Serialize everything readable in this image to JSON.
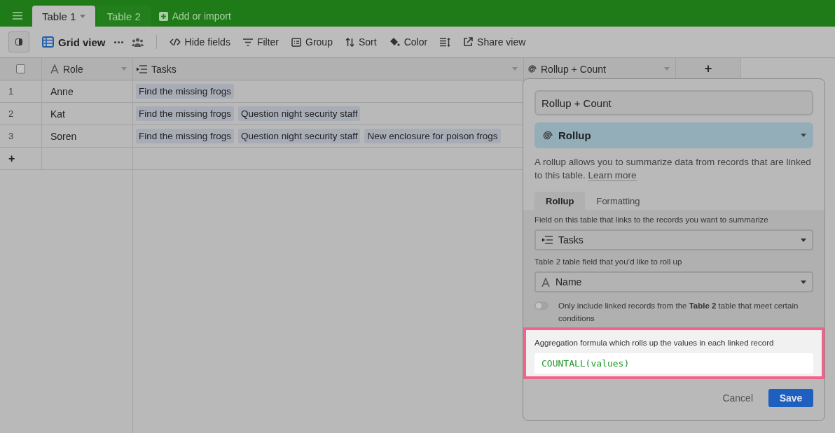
{
  "top_tabs": [
    {
      "label": "Table 1",
      "selected": true
    },
    {
      "label": "Table 2",
      "selected": false
    }
  ],
  "add_table": "Add or import",
  "toolbar": {
    "view_name": "Grid view",
    "items": [
      {
        "kind": "hide",
        "label": "Hide fields"
      },
      {
        "kind": "filter",
        "label": "Filter"
      },
      {
        "kind": "group",
        "label": "Group"
      },
      {
        "kind": "sort",
        "label": "Sort"
      },
      {
        "kind": "color",
        "label": "Color"
      },
      {
        "kind": "height"
      },
      {
        "kind": "share",
        "label": "Share view"
      }
    ]
  },
  "table": {
    "select_all": {
      "checked": false
    },
    "columns": [
      {
        "kind": "text",
        "name": "Role"
      },
      {
        "kind": "link",
        "name": "Tasks"
      },
      {
        "kind": "rollup",
        "name": "Rollup + Count"
      }
    ],
    "add_column": "+",
    "rows": [
      {
        "number": "1",
        "role": "Anne",
        "tasks": [
          "Find the missing frogs"
        ]
      },
      {
        "number": "2",
        "role": "Kat",
        "tasks": [
          "Find the missing frogs",
          "Question night security staff"
        ]
      },
      {
        "number": "3",
        "role": "Soren",
        "tasks": [
          "Find the missing frogs",
          "Question night security staff",
          "New enclosure for poison frogs"
        ]
      }
    ],
    "add_row": "+"
  },
  "popover": {
    "field_name": "Rollup + Count",
    "field_type": "Rollup",
    "description": "A rollup allows you to summarize data from records that are linked to this table.",
    "learn_more": "Learn more",
    "tabs": [
      {
        "label": "Rollup",
        "selected": true
      },
      {
        "label": "Formatting",
        "selected": false
      }
    ],
    "link_label": "Field on this table that links to the records you want to summarize",
    "link_value": "Tasks",
    "roll_label": "Table 2 table field that you’d like to roll up",
    "roll_value": "Name",
    "condition": {
      "on": false,
      "text": "Only include linked records from the **Table 2** table that meet certain conditions"
    },
    "formula_label": "Aggregation formula which rolls up the values in each linked record",
    "formula": "COUNTALL(values)",
    "cancel": "Cancel",
    "save": "Save"
  }
}
